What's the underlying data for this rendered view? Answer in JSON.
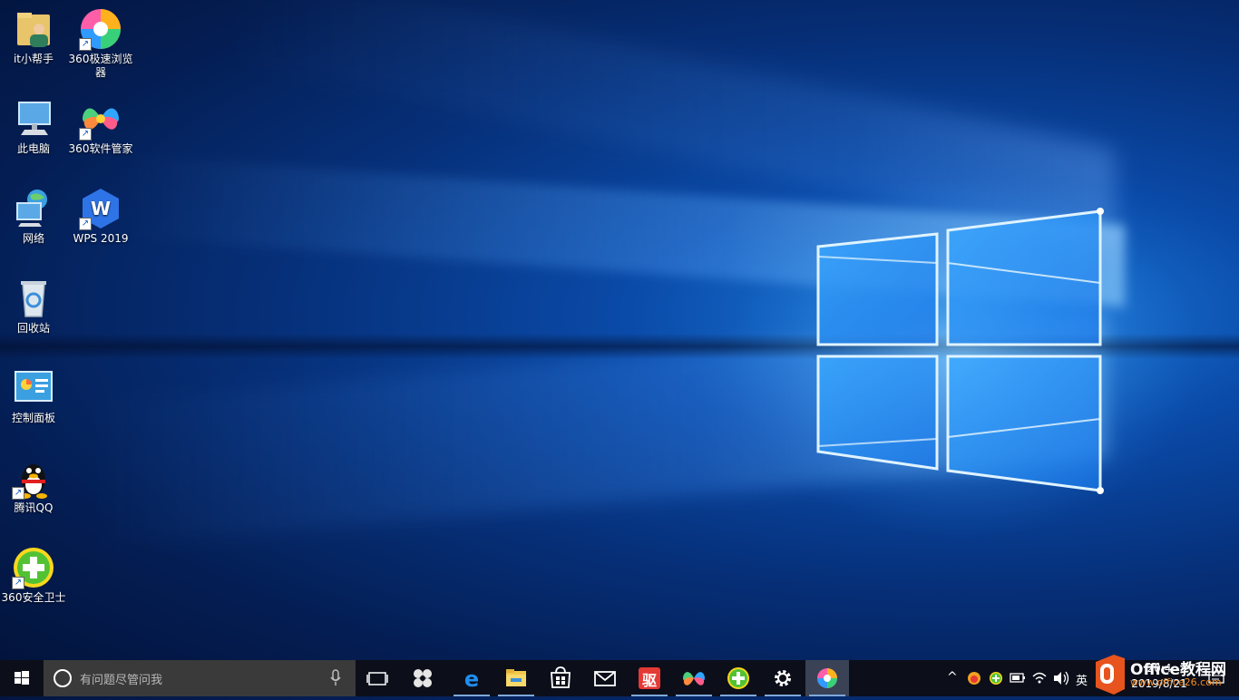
{
  "desktop": {
    "icons": [
      {
        "label": "it小帮手",
        "icon": "user-folder-icon",
        "shortcut": false
      },
      {
        "label": "360极速浏览器",
        "icon": "360-browser-icon",
        "shortcut": true
      },
      {
        "label": "此电脑",
        "icon": "this-pc-icon",
        "shortcut": false
      },
      {
        "label": "360软件管家",
        "icon": "360-software-manager-icon",
        "shortcut": true
      },
      {
        "label": "网络",
        "icon": "network-icon",
        "shortcut": false
      },
      {
        "label": "WPS 2019",
        "icon": "wps-icon",
        "shortcut": true
      },
      {
        "label": "回收站",
        "icon": "recycle-bin-icon",
        "shortcut": false
      },
      {
        "label": "控制面板",
        "icon": "control-panel-icon",
        "shortcut": false
      },
      {
        "label": "腾讯QQ",
        "icon": "qq-icon",
        "shortcut": true
      },
      {
        "label": "360安全卫士",
        "icon": "360-safe-icon",
        "shortcut": true
      }
    ]
  },
  "taskbar": {
    "search_placeholder": "有问题尽管问我",
    "pinned": [
      {
        "name": "task-view",
        "icon": "task-view-icon"
      },
      {
        "name": "pinwheel",
        "icon": "pinwheel-icon"
      },
      {
        "name": "edge",
        "icon": "edge-icon"
      },
      {
        "name": "file-explorer",
        "icon": "folder-icon"
      },
      {
        "name": "store",
        "icon": "store-icon"
      },
      {
        "name": "mail",
        "icon": "mail-icon"
      },
      {
        "name": "driver",
        "icon": "driver-app-icon",
        "glyph": "驱"
      },
      {
        "name": "360-software-manager",
        "icon": "360-software-manager-icon"
      },
      {
        "name": "360-safe",
        "icon": "360-safe-icon"
      },
      {
        "name": "settings",
        "icon": "gear-icon"
      },
      {
        "name": "360-browser",
        "icon": "360-browser-icon"
      }
    ],
    "tray": {
      "chevron": "^",
      "ime": "英"
    },
    "clock": {
      "time": "20:4",
      "date": "2019/8/21"
    }
  },
  "watermark": {
    "title": "Office教程网",
    "url": "www.office26.com"
  },
  "colors": {
    "taskbar": "#0c0f1a",
    "search_box": "#3a3a3a",
    "accent": "#1e7fe0",
    "watermark_orange": "#e8541d"
  }
}
